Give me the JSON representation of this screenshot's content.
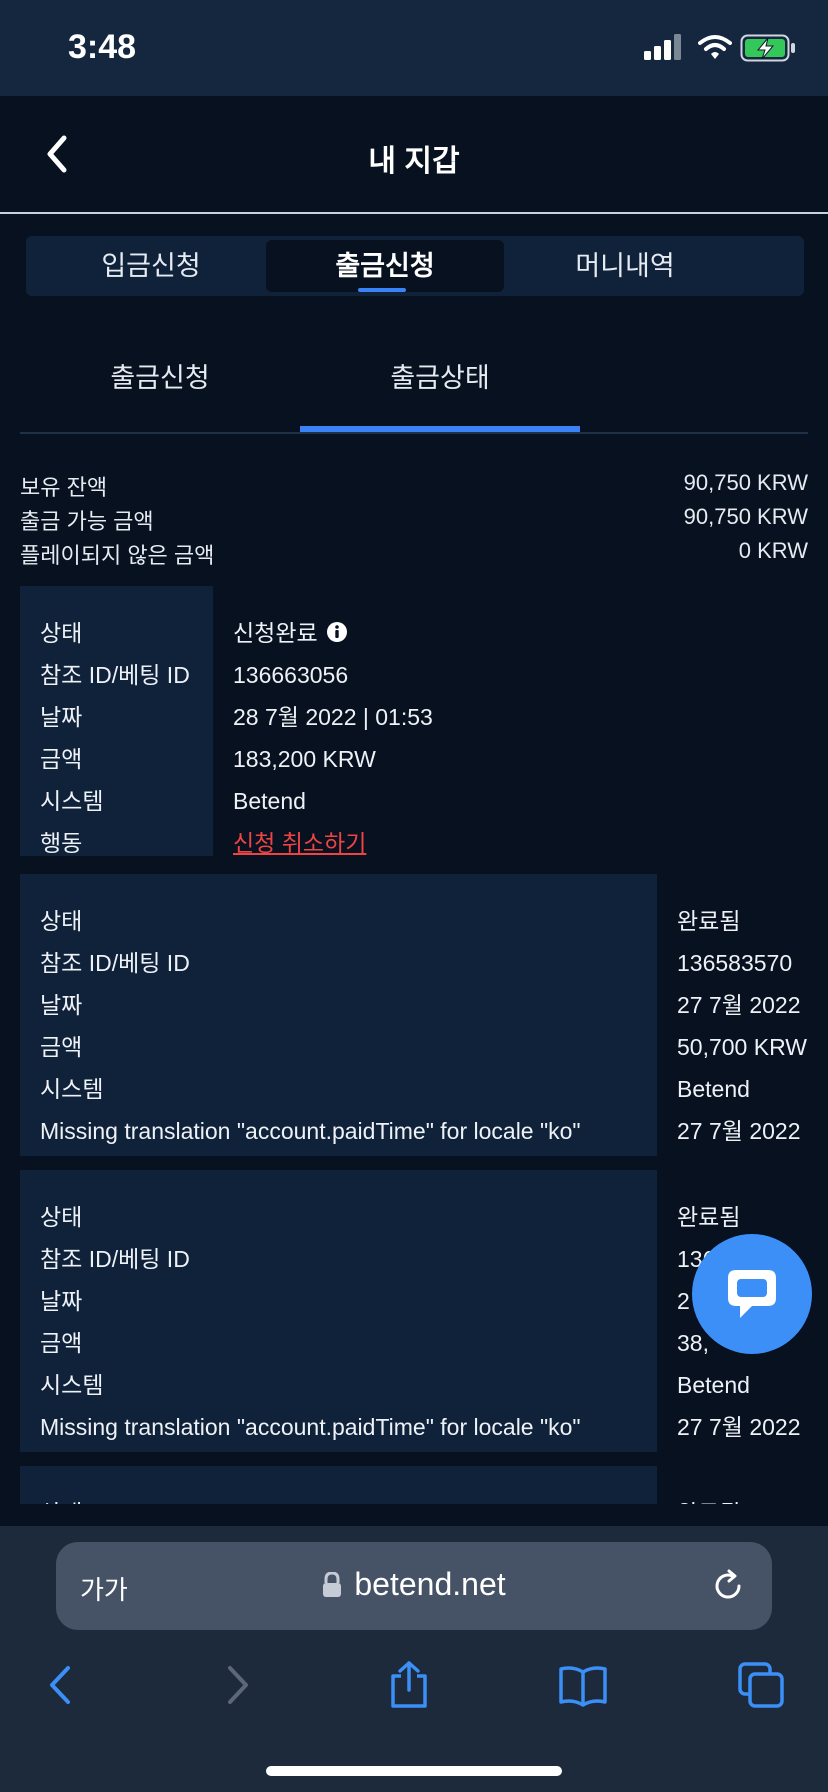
{
  "status_bar": {
    "time": "3:48"
  },
  "header": {
    "title": "내 지갑"
  },
  "main_tabs": [
    {
      "label": "입금신청"
    },
    {
      "label": "출금신청"
    },
    {
      "label": "머니내역"
    }
  ],
  "sub_tabs": [
    {
      "label": "출금신청"
    },
    {
      "label": "출금상태"
    }
  ],
  "balances": [
    {
      "label": "보유 잔액",
      "value": "90,750 KRW"
    },
    {
      "label": "출금 가능 금액",
      "value": "90,750 KRW"
    },
    {
      "label": "플레이되지 않은 금액",
      "value": "0 KRW"
    }
  ],
  "pending_request": {
    "labels": [
      "상태",
      "참조 ID/베팅 ID",
      "날짜",
      "금액",
      "시스템",
      "행동"
    ],
    "status": "신청완료",
    "reference_id": "136663056",
    "date": "28 7월 2022 | 01:53",
    "amount": "183,200 KRW",
    "system": "Betend",
    "action": "신청 취소하기"
  },
  "history": {
    "labels": [
      "상태",
      "참조 ID/베팅 ID",
      "날짜",
      "금액",
      "시스템",
      "Missing translation \"account.paidTime\" for locale \"ko\""
    ],
    "items": [
      {
        "status": "완료됨",
        "reference_id": "136583570",
        "date": "27 7월 2022",
        "amount": "50,700 KRW",
        "system": "Betend",
        "paid_time": "27 7월 2022"
      },
      {
        "status": "완료됨",
        "reference_id": "136",
        "date": "2",
        "amount": "38,",
        "system": "Betend",
        "paid_time": "27 7월 2022"
      },
      {
        "status": "완료됨"
      }
    ],
    "partial_label": "상태"
  },
  "browser": {
    "text_size_label": "가가",
    "url": "betend.net"
  }
}
